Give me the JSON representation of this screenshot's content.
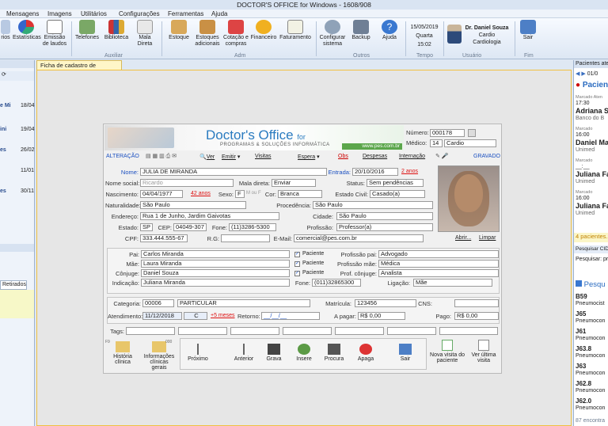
{
  "window": {
    "title": "DOCTOR'S OFFICE for Windows  - 1608/908"
  },
  "menu": [
    "Mensagens",
    "Imagens",
    "Utilitários",
    "Configurações",
    "Ferramentas",
    "Ajuda"
  ],
  "ribbon": {
    "buttons": [
      {
        "label": "rios",
        "icon": "calendar-icon"
      },
      {
        "label": "Estatísticas",
        "icon": "chart-icon"
      },
      {
        "label": "Emissão de laudos",
        "icon": "document-icon"
      },
      {
        "label": "Telefones",
        "icon": "phone-book-icon"
      },
      {
        "label": "Biblioteca",
        "icon": "library-icon"
      },
      {
        "label": "Mala Direta",
        "icon": "mail-icon"
      },
      {
        "label": "Estoque",
        "icon": "box-icon"
      },
      {
        "label": "Estoques adicionais",
        "icon": "boxes-icon"
      },
      {
        "label": "Cotação e compras",
        "icon": "cart-icon"
      },
      {
        "label": "Financeiro",
        "icon": "money-icon"
      },
      {
        "label": "Faturamento",
        "icon": "invoice-icon"
      },
      {
        "label": "Configurar sistema",
        "icon": "gear-icon"
      },
      {
        "label": "Backup",
        "icon": "backup-icon"
      },
      {
        "label": "Ajuda",
        "icon": "help-icon"
      },
      {
        "label": "Sair",
        "icon": "exit-icon"
      }
    ],
    "groups": {
      "auxiliar": "Auxiliar",
      "adm": "Adm",
      "outros": "Outros",
      "tempo": "Tempo",
      "usuario": "Usuário",
      "fim": "Fim"
    },
    "date": "15/05/2019",
    "weekday": "Quarta",
    "time": "15:02",
    "user_name": "Dr. Daniel Souza",
    "user_role": "Cardio",
    "user_specialty": "Cardiologia"
  },
  "left_panel": {
    "items": [
      {
        "name": "e Mi",
        "date": "18/04"
      },
      {
        "name": "ini",
        "date": "19/04"
      },
      {
        "name": "es",
        "date": "26/02"
      },
      {
        "name": "",
        "date": "11/01"
      },
      {
        "name": "es",
        "date": "30/11"
      }
    ],
    "tab": "Retirados"
  },
  "doc_tab": "Ficha de cadastro de pacientes",
  "banner": {
    "brand": "Doctor's Office",
    "brand_suffix": "for",
    "subtitle": "PROGRAMAS & SOLUÇÕES INFORMÁTICA",
    "url": "www.pes.com.br",
    "numero_label": "Número:",
    "numero": "000178",
    "medico_label": "Médico:",
    "medico_code": "14",
    "medico_name": "Cardio"
  },
  "toolbar": {
    "mode": "ALTERAÇÃO",
    "ver": "Ver",
    "emitir": "Emitir",
    "visitas": "Visitas",
    "espera": "Espera",
    "obs": "Obs",
    "despesas": "Despesas",
    "internacao": "Internação",
    "status": "GRAVADO"
  },
  "patient": {
    "nome_label": "Nome:",
    "nome": "JULIA DE MIRANDA",
    "entrada_label": "Entrada:",
    "entrada": "20/10/2016",
    "entrada_anos": "2 anos",
    "nome_social_label": "Nome social:",
    "nome_social_placeholder": "Ricardo",
    "mala_label": "Mala direta:",
    "mala": "Enviar",
    "status_label": "Status:",
    "status": "Sem pendências",
    "nascimento_label": "Nascimento:",
    "nascimento": "04/04/1977",
    "idade": "42 anos",
    "sexo_label": "Sexo:",
    "sexo": "F",
    "sexo_opts": "M ou F",
    "cor_label": "Cor:",
    "cor": "Branca",
    "estado_civil_label": "Estado Civil:",
    "estado_civil": "Casado(a)",
    "naturalidade_label": "Naturalidade:",
    "naturalidade": "São Paulo",
    "procedencia_label": "Procedência:",
    "procedencia": "São Paulo",
    "endereco_label": "Endereço:",
    "endereco": "Rua 1 de Junho, Jardim Gaivotas",
    "cidade_label": "Cidade:",
    "cidade": "São Paulo",
    "estado_label": "Estado:",
    "estado": "SP",
    "cep_label": "CEP:",
    "cep": "04049-307",
    "fone_label": "Fone:",
    "fone": "(11)3286-5300",
    "profissao_label": "Profissão:",
    "profissao": "Professor(a)",
    "cpf_label": "CPF:",
    "cpf": "333.444.555-67",
    "rg_label": "R.G:",
    "rg": "",
    "email_label": "E-Mail:",
    "email": "comercial@pes.com.br",
    "abrir": "Abrir...",
    "limpar": "Limpar"
  },
  "family": {
    "pai_label": "Pai:",
    "pai": "Carlos Miranda",
    "mae_label": "Mãe:",
    "mae": "Laura Miranda",
    "conjuge_label": "Cônjuge:",
    "conjuge": "Daniel Souza",
    "indicacao_label": "Indicação:",
    "indicacao": "Juliana Miranda",
    "paciente_label": "Paciente",
    "prof_pai_label": "Profissão pai:",
    "prof_pai": "Advogado",
    "prof_mae_label": "Profissão mãe:",
    "prof_mae": "Médica",
    "prof_conjuge_label": "Prof. cônjuge:",
    "prof_conjuge": "Analista",
    "fone_label": "Fone:",
    "fone": "(011)32865300",
    "ligacao_label": "Ligação:",
    "ligacao": "Mãe"
  },
  "billing": {
    "categoria_label": "Categoria:",
    "categoria_code": "00006",
    "categoria": "PARTICULAR",
    "matricula_label": "Matrícula:",
    "matricula": "123456",
    "cns_label": "CNS:",
    "cns": "",
    "atendimento_label": "Atendimento:",
    "atendimento": "11/12/2018",
    "atendimento_tipo": "C",
    "meses": "+5 meses",
    "retorno_label": "Retorno:",
    "retorno": "__/__/__",
    "apagar_label": "A pagar:",
    "apagar": "R$ 0,00",
    "pago_label": "Pago:",
    "pago": "R$ 0,00",
    "tags_label": "Tags:"
  },
  "actions": [
    {
      "key": "F4",
      "label": "Próximo"
    },
    {
      "key": "",
      "label": "Anterior"
    },
    {
      "key": "F2",
      "label": "Grava"
    },
    {
      "key": "F3",
      "label": "Insere"
    },
    {
      "key": "F5",
      "label": "Procura"
    },
    {
      "key": "F8",
      "label": "Apaga"
    },
    {
      "key": "Esc",
      "label": "Sair"
    },
    {
      "key": "F11",
      "label": "Nova visita do paciente"
    },
    {
      "key": "F12",
      "label": "Ver última visita"
    }
  ],
  "side_actions": [
    {
      "key": "F9",
      "label": "História clínica"
    },
    {
      "key": "000",
      "label": "Informações clínicas gerais"
    }
  ],
  "right_panel": {
    "header": "Pacientes aten",
    "nav_date": "01/0",
    "title": "Pacien",
    "marcado": "Marcado",
    "aten": "Aten",
    "patients": [
      {
        "time": "17:30",
        "name": "Adriana S",
        "plan": "Banco do B"
      },
      {
        "time": "16:00",
        "name": "Daniel Ma",
        "plan": "Unimed"
      },
      {
        "time": "__:__",
        "name": "Juliana Fa",
        "plan": "Unimed"
      },
      {
        "time": "16:00",
        "name": "Juliana Fa",
        "plan": "Unimed"
      }
    ],
    "count": "4 pacientes.",
    "search_label": "Pesquisar CID",
    "search_prompt": "Pesquisar:",
    "search_value": "pr",
    "result_header": "Pesqu",
    "cids": [
      {
        "code": "B59",
        "desc": "Pneumocist"
      },
      {
        "code": "J65",
        "desc": "Pneumocon"
      },
      {
        "code": "J61",
        "desc": "Pneumocon"
      },
      {
        "code": "J63.8",
        "desc": "Pneumocon"
      },
      {
        "code": "J63",
        "desc": "Pneumocon"
      },
      {
        "code": "J62.8",
        "desc": "Pneumocon"
      },
      {
        "code": "J62.0",
        "desc": "Pneumocon"
      }
    ],
    "footer": "87 encontra"
  }
}
